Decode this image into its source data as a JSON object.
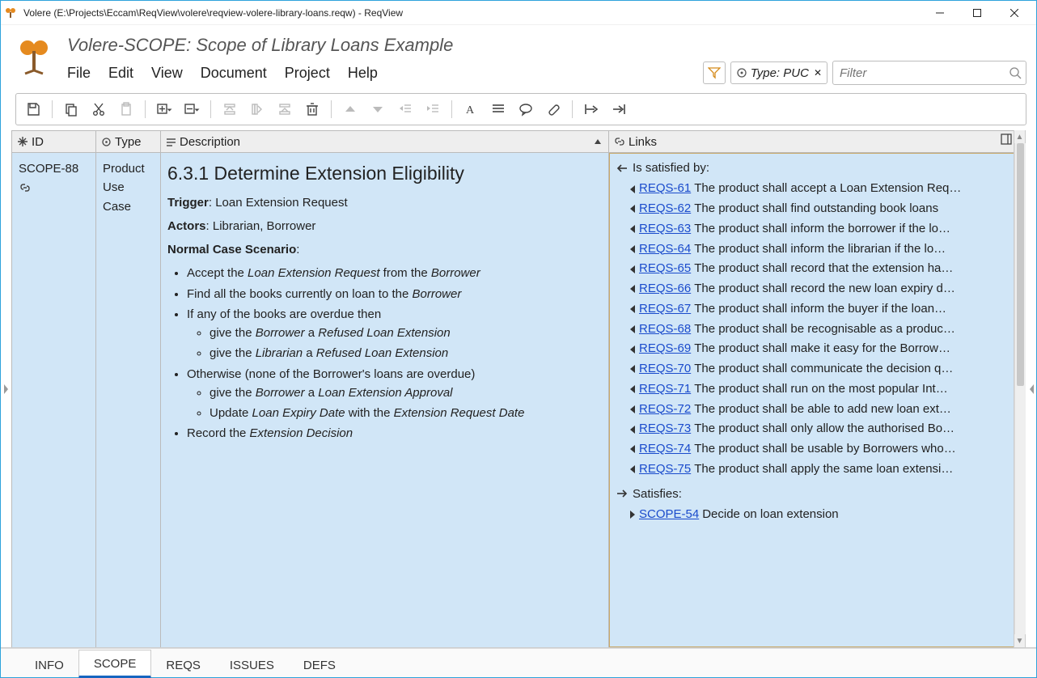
{
  "window": {
    "title": "Volere (E:\\Projects\\Eccam\\ReqView\\volere\\reqview-volere-library-loans.reqw) - ReqView"
  },
  "doc_title": "Volere-SCOPE: Scope of Library Loans Example",
  "menu": {
    "file": "File",
    "edit": "Edit",
    "view": "View",
    "document": "Document",
    "project": "Project",
    "help": "Help"
  },
  "filter": {
    "chip_label": "Type: PUC",
    "placeholder": "Filter"
  },
  "columns": {
    "id": "ID",
    "type": "Type",
    "description": "Description",
    "links": "Links"
  },
  "row": {
    "id": "SCOPE-88",
    "type": "Product Use Case",
    "desc": {
      "heading": "6.3.1 Determine Extension Eligibility",
      "trigger_label": "Trigger",
      "trigger_value": ": Loan Extension Request",
      "actors_label": "Actors",
      "actors_value": ": Librarian, Borrower",
      "scenario_label": "Normal Case Scenario",
      "bullets": {
        "b1_pre": "Accept the ",
        "b1_i1": "Loan Extension Request",
        "b1_mid": " from the ",
        "b1_i2": "Borrower",
        "b2_pre": "Find all the books currently on loan to the ",
        "b2_i1": "Borrower",
        "b3": "If any of the books are overdue then",
        "b3a_pre": "give the ",
        "b3a_i1": "Borrower",
        "b3a_mid": " a ",
        "b3a_i2": "Refused Loan Extension",
        "b3b_pre": "give the ",
        "b3b_i1": "Librarian",
        "b3b_mid": " a ",
        "b3b_i2": "Refused Loan Extension",
        "b4": "Otherwise (none of the Borrower's loans are overdue)",
        "b4a_pre": "give the ",
        "b4a_i1": "Borrower",
        "b4a_mid": " a ",
        "b4a_i2": "Loan Extension Approval",
        "b4b_pre": "Update ",
        "b4b_i1": "Loan Expiry Date",
        "b4b_mid": " with the ",
        "b4b_i2": "Extension Request Date",
        "b5_pre": "Record the ",
        "b5_i1": "Extension Decision"
      }
    }
  },
  "links": {
    "satisfied_by_label": "Is satisfied by:",
    "satisfies_label": "Satisfies:",
    "satisfied_by": [
      {
        "id": "REQS-61",
        "text": "The product shall accept a Loan Extension Req…"
      },
      {
        "id": "REQS-62",
        "text": "The product shall find outstanding book loans"
      },
      {
        "id": "REQS-63",
        "text": "The product shall inform the borrower if the lo…"
      },
      {
        "id": "REQS-64",
        "text": "The product shall inform the librarian if the lo…"
      },
      {
        "id": "REQS-65",
        "text": "The product shall record that the extension ha…"
      },
      {
        "id": "REQS-66",
        "text": "The product shall record the new loan expiry d…"
      },
      {
        "id": "REQS-67",
        "text": "The product shall  inform the buyer if the loan…"
      },
      {
        "id": "REQS-68",
        "text": "The product shall be recognisable as a produc…"
      },
      {
        "id": "REQS-69",
        "text": "The product shall make it easy for the Borrow…"
      },
      {
        "id": "REQS-70",
        "text": "The product shall communicate the decision q…"
      },
      {
        "id": "REQS-71",
        "text": "The product shall run on the most popular Int…"
      },
      {
        "id": "REQS-72",
        "text": "The product shall be able to add new loan ext…"
      },
      {
        "id": "REQS-73",
        "text": "The product shall only allow the authorised Bo…"
      },
      {
        "id": "REQS-74",
        "text": "The product shall be usable by Borrowers who…"
      },
      {
        "id": "REQS-75",
        "text": "The product shall apply the same loan extensi…"
      }
    ],
    "satisfies": [
      {
        "id": "SCOPE-54",
        "text": "Decide on loan extension"
      }
    ]
  },
  "tabs": {
    "info": "INFO",
    "scope": "SCOPE",
    "reqs": "REQS",
    "issues": "ISSUES",
    "defs": "DEFS"
  }
}
